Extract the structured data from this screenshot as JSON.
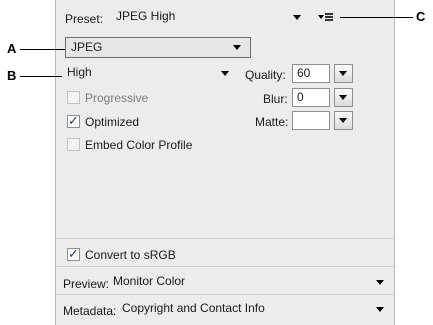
{
  "preset": {
    "label": "Preset:",
    "value": "JPEG High"
  },
  "format": {
    "value": "JPEG"
  },
  "compression_quality": {
    "value": "High"
  },
  "quality": {
    "label": "Quality:",
    "value": "60"
  },
  "blur": {
    "label": "Blur:",
    "value": "0"
  },
  "matte": {
    "label": "Matte:",
    "value": ""
  },
  "options": {
    "progressive": {
      "label": "Progressive",
      "checked": false,
      "enabled": false
    },
    "optimized": {
      "label": "Optimized",
      "checked": true,
      "enabled": true
    },
    "embed_color_profile": {
      "label": "Embed Color Profile",
      "checked": false,
      "enabled": false
    }
  },
  "convert_srgb": {
    "label": "Convert to sRGB",
    "checked": true
  },
  "preview": {
    "label": "Preview:",
    "value": "Monitor Color"
  },
  "metadata": {
    "label": "Metadata:",
    "value": "Copyright and Contact Info"
  },
  "callouts": {
    "a": "A",
    "b": "B",
    "c": "C"
  },
  "icons": {
    "panel_menu": "panel-menu-icon",
    "dropdown": "chevron-down-icon",
    "check": "checkmark-icon"
  }
}
